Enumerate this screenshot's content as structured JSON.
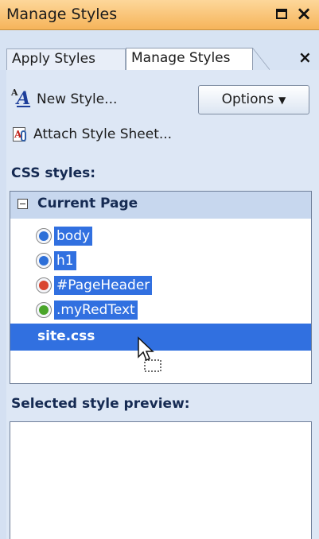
{
  "window": {
    "title": "Manage Styles"
  },
  "tabs": [
    {
      "label": "Apply Styles",
      "selected": false
    },
    {
      "label": "Manage Styles",
      "selected": true
    }
  ],
  "toolbar": {
    "new_style": "New Style...",
    "attach_style_sheet": "Attach Style Sheet...",
    "options": "Options"
  },
  "css_styles_label": "CSS styles:",
  "tree": {
    "group": "Current Page",
    "rules": [
      {
        "name": "body",
        "dot_color": "#2d6fd8"
      },
      {
        "name": "h1",
        "dot_color": "#2d6fd8"
      },
      {
        "name": "#PageHeader",
        "dot_color": "#d9452f"
      },
      {
        "name": ".myRedText",
        "dot_color": "#4aa52a"
      }
    ],
    "stylesheet": "site.css"
  },
  "preview_label": "Selected style preview:",
  "colors": {
    "selection": "#3170e0",
    "titlebar": "#f6b45a"
  }
}
